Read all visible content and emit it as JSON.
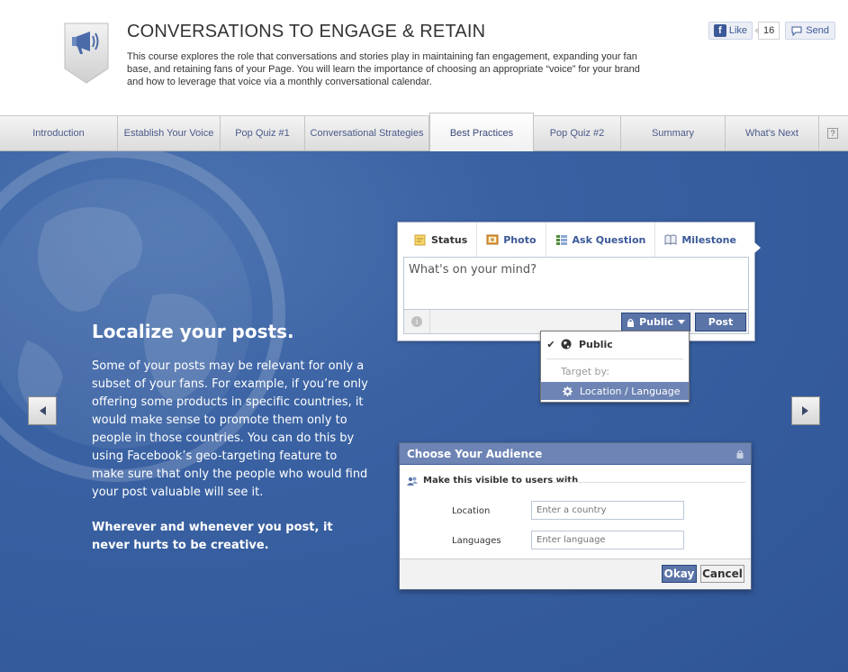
{
  "header": {
    "title": "CONVERSATIONS TO ENGAGE & RETAIN",
    "description": "This course explores the role that conversations and stories play in maintaining fan engagement, expanding your fan base, and retaining fans of your Page. You will learn the importance of choosing an appropriate “voice” for your brand and how to leverage that voice via a monthly conversational calendar.",
    "badge_icon": "megaphone-icon"
  },
  "social": {
    "like_label": "Like",
    "like_count": "16",
    "send_label": "Send"
  },
  "tabs": [
    {
      "label": "Introduction"
    },
    {
      "label": "Establish Your Voice"
    },
    {
      "label": "Pop Quiz #1"
    },
    {
      "label": "Conversational Strategies"
    },
    {
      "label": "Best Practices"
    },
    {
      "label": "Pop Quiz #2"
    },
    {
      "label": "Summary"
    },
    {
      "label": "What's Next"
    }
  ],
  "help_label": "?",
  "content": {
    "heading": "Localize your posts.",
    "body": "Some of your posts may be relevant for only a subset of your fans. For example, if you’re only offering some products in specific countries, it would make sense to promote them only to people in those countries. You can do this by using Facebook’s geo-targeting feature to make sure that only the people who would find your post valuable will see it.",
    "closing": "Wherever and whenever you post, it never hurts to be creative."
  },
  "composer": {
    "tabs": [
      {
        "label": "Status"
      },
      {
        "label": "Photo"
      },
      {
        "label": "Ask Question"
      },
      {
        "label": "Milestone"
      }
    ],
    "placeholder": "What's on your mind?",
    "privacy_label": "Public",
    "post_label": "Post"
  },
  "dropdown": {
    "public_label": "Public",
    "target_label": "Target by:",
    "location_label": "Location / Language"
  },
  "dialog": {
    "title": "Choose Your Audience",
    "subtitle": "Make this visible to users with",
    "location_label": "Location",
    "location_placeholder": "Enter a country",
    "languages_label": "Languages",
    "languages_placeholder": "Enter language",
    "okay_label": "Okay",
    "cancel_label": "Cancel"
  },
  "colors": {
    "stage_blue": "#3a62a3",
    "facebook_blue": "#3b5998",
    "button_blue": "#5b74a8",
    "highlight_blue": "#6d84b4"
  }
}
